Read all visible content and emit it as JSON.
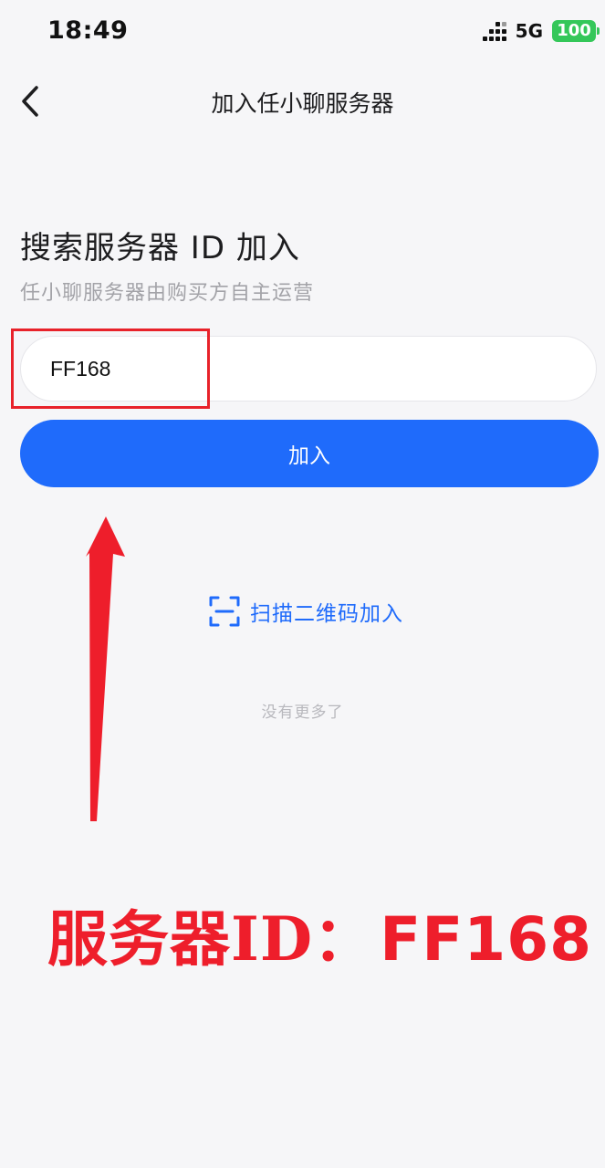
{
  "status_bar": {
    "time": "18:49",
    "network": "5G",
    "battery": "100",
    "signal_icon": "signal-icon"
  },
  "nav": {
    "title": "加入任小聊服务器",
    "back_icon": "chevron-left-icon"
  },
  "main": {
    "heading": "搜索服务器 ID 加入",
    "subheading": "任小聊服务器由购买方自主运营",
    "server_id_input": {
      "value": "FF168",
      "placeholder": ""
    },
    "join_button": "加入",
    "scan_link": {
      "label": "扫描二维码加入",
      "icon": "scan-qr-icon"
    },
    "no_more": "没有更多了"
  },
  "annotation": {
    "label": "服务器ID：",
    "value": "FF168",
    "color": "#ee1e2b"
  },
  "colors": {
    "accent": "#1f6bfb",
    "highlight": "#e8222a",
    "battery": "#34c759"
  }
}
